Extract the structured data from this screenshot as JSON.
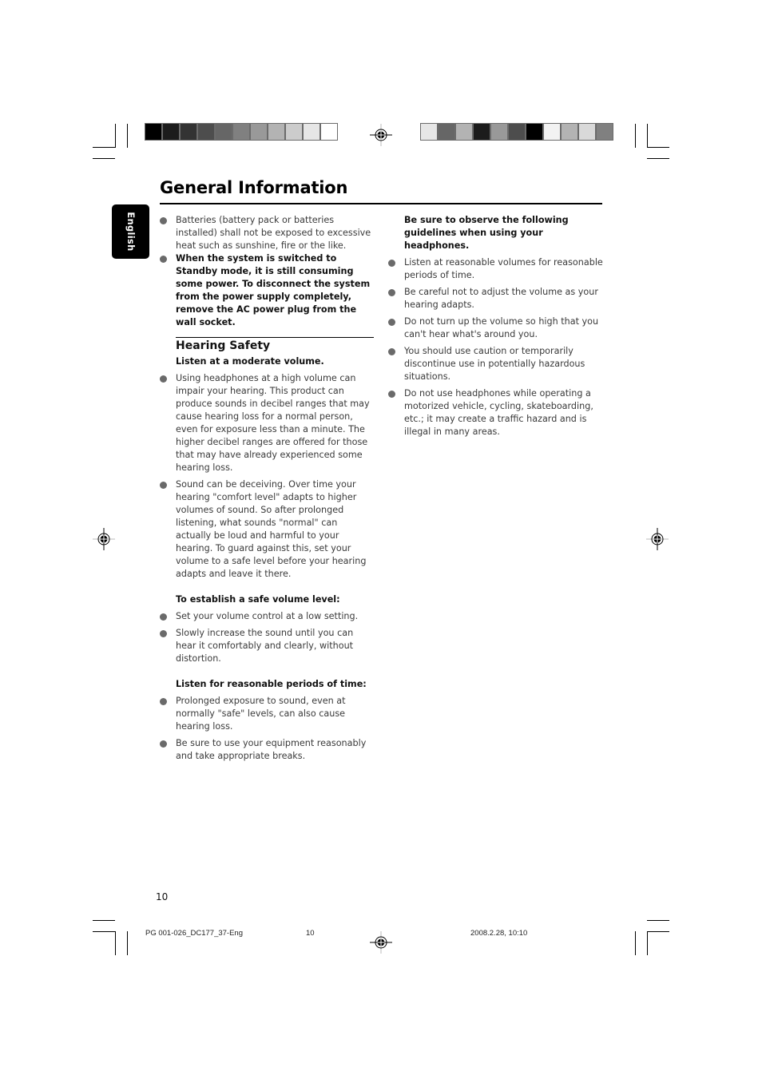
{
  "print_marks": {
    "color_bar_left": [
      "#000000",
      "#1c1c1c",
      "#333333",
      "#4d4d4d",
      "#666666",
      "#808080",
      "#999999",
      "#b3b3b3",
      "#cccccc",
      "#e6e6e6",
      "#ffffff"
    ],
    "color_bar_right": [
      "#e6e6e6",
      "#666666",
      "#b3b3b3",
      "#1c1c1c",
      "#999999",
      "#4d4d4d",
      "#000000",
      "#f2f2f2",
      "#b3b3b3",
      "#d9d9d9",
      "#808080"
    ]
  },
  "language_tab": "English",
  "page_title": "General Information",
  "left_column": {
    "intro_bullets": [
      {
        "text": "Batteries (battery pack or batteries installed) shall not be exposed to excessive heat such as sunshine, fire or the like.",
        "bold": false
      },
      {
        "text": "When the system is switched to Standby mode, it is still consuming some power. To disconnect the system from the power supply completely, remove the AC power plug from the wall socket.",
        "bold": true
      }
    ],
    "section_title": "Hearing Safety",
    "groups": [
      {
        "heading": "Listen at a moderate volume.",
        "bullets": [
          "Using headphones at a high volume can impair your hearing. This product can produce sounds in decibel ranges that may cause hearing loss for a normal person, even for exposure less than a minute. The higher decibel ranges are offered for those that may have already experienced some hearing loss.",
          "Sound can be deceiving.  Over time your hearing \"comfort level\" adapts to higher volumes of sound.  So after prolonged listening, what sounds \"normal\" can actually be loud and harmful to your hearing. To guard against this, set your volume to a safe level before your hearing adapts and leave it there."
        ]
      },
      {
        "heading": "To establish a safe volume level:",
        "bullets": [
          "Set your volume control at a low setting.",
          "Slowly increase the sound until you can hear it comfortably and clearly, without distortion."
        ]
      },
      {
        "heading": "Listen for reasonable periods of time:",
        "bullets": [
          "Prolonged exposure to sound, even at normally \"safe\" levels, can also cause hearing loss.",
          "Be sure to use your equipment reasonably and take appropriate breaks."
        ]
      }
    ]
  },
  "right_column": {
    "heading": "Be sure to observe the following guidelines when using your headphones.",
    "bullets": [
      "Listen at reasonable volumes for reasonable periods of time.",
      "Be careful not to adjust the volume as your hearing adapts.",
      "Do not turn up the volume so high that you can't hear what's around you.",
      "You should use caution or temporarily discontinue use in potentially hazardous situations.",
      "Do not use headphones while operating a motorized vehicle, cycling, skateboarding, etc.; it may create a traffic hazard and is illegal in many areas."
    ]
  },
  "page_number": "10",
  "slug": {
    "file": "PG 001-026_DC177_37-Eng",
    "page": "10",
    "timestamp": "2008.2.28, 10:10"
  }
}
